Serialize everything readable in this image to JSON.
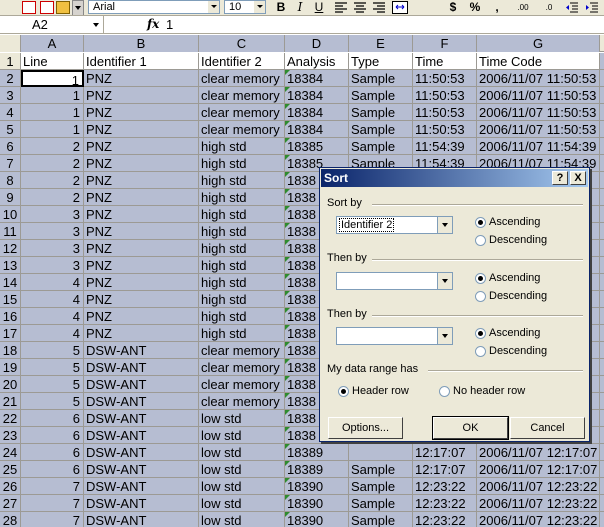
{
  "toolbar": {
    "font_name": "Arial",
    "font_size": "10",
    "bold": "B",
    "italic": "I",
    "underline": "U",
    "currency": "$",
    "percent": "%",
    "comma": ",",
    "increase_decimal": ".00",
    "decrease_decimal": ".0"
  },
  "formula_bar": {
    "cell_ref": "A2",
    "fx": "fx",
    "value": "1"
  },
  "sheet": {
    "columns": [
      "A",
      "B",
      "C",
      "D",
      "E",
      "F",
      "G"
    ],
    "header": [
      "Line",
      "Identifier 1",
      "Identifier 2",
      "Analysis",
      "Type",
      "Time",
      "Time Code"
    ],
    "rows": [
      {
        "n": "2",
        "cells": [
          "1",
          "PNZ",
          "clear memory",
          "18384",
          "Sample",
          "11:50:53",
          "2006/11/07 11:50:53"
        ]
      },
      {
        "n": "3",
        "cells": [
          "1",
          "PNZ",
          "clear memory",
          "18384",
          "Sample",
          "11:50:53",
          "2006/11/07 11:50:53"
        ]
      },
      {
        "n": "4",
        "cells": [
          "1",
          "PNZ",
          "clear memory",
          "18384",
          "Sample",
          "11:50:53",
          "2006/11/07 11:50:53"
        ]
      },
      {
        "n": "5",
        "cells": [
          "1",
          "PNZ",
          "clear memory",
          "18384",
          "Sample",
          "11:50:53",
          "2006/11/07 11:50:53"
        ]
      },
      {
        "n": "6",
        "cells": [
          "2",
          "PNZ",
          "high std",
          "18385",
          "Sample",
          "11:54:39",
          "2006/11/07 11:54:39"
        ]
      },
      {
        "n": "7",
        "cells": [
          "2",
          "PNZ",
          "high std",
          "18385",
          "Sample",
          "11:54:39",
          "2006/11/07 11:54:39"
        ]
      },
      {
        "n": "8",
        "cells": [
          "2",
          "PNZ",
          "high std",
          "1838",
          "",
          "",
          ""
        ]
      },
      {
        "n": "9",
        "cells": [
          "2",
          "PNZ",
          "high std",
          "1838",
          "",
          "",
          ""
        ]
      },
      {
        "n": "10",
        "cells": [
          "3",
          "PNZ",
          "high std",
          "1838",
          "",
          "",
          ""
        ]
      },
      {
        "n": "11",
        "cells": [
          "3",
          "PNZ",
          "high std",
          "1838",
          "",
          "",
          ""
        ]
      },
      {
        "n": "12",
        "cells": [
          "3",
          "PNZ",
          "high std",
          "1838",
          "",
          "",
          ""
        ]
      },
      {
        "n": "13",
        "cells": [
          "3",
          "PNZ",
          "high std",
          "1838",
          "",
          "",
          ""
        ]
      },
      {
        "n": "14",
        "cells": [
          "4",
          "PNZ",
          "high std",
          "1838",
          "",
          "",
          ""
        ]
      },
      {
        "n": "15",
        "cells": [
          "4",
          "PNZ",
          "high std",
          "1838",
          "",
          "",
          ""
        ]
      },
      {
        "n": "16",
        "cells": [
          "4",
          "PNZ",
          "high std",
          "1838",
          "",
          "",
          ""
        ]
      },
      {
        "n": "17",
        "cells": [
          "4",
          "PNZ",
          "high std",
          "1838",
          "",
          "",
          ""
        ]
      },
      {
        "n": "18",
        "cells": [
          "5",
          "DSW-ANT",
          "clear memory",
          "1838",
          "",
          "",
          ""
        ]
      },
      {
        "n": "19",
        "cells": [
          "5",
          "DSW-ANT",
          "clear memory",
          "1838",
          "",
          "",
          ""
        ]
      },
      {
        "n": "20",
        "cells": [
          "5",
          "DSW-ANT",
          "clear memory",
          "1838",
          "",
          "",
          ""
        ]
      },
      {
        "n": "21",
        "cells": [
          "5",
          "DSW-ANT",
          "clear memory",
          "1838",
          "",
          "",
          ""
        ]
      },
      {
        "n": "22",
        "cells": [
          "6",
          "DSW-ANT",
          "low std",
          "1838",
          "",
          "",
          ""
        ]
      },
      {
        "n": "23",
        "cells": [
          "6",
          "DSW-ANT",
          "low std",
          "1838",
          "",
          "",
          ""
        ]
      },
      {
        "n": "24",
        "cells": [
          "6",
          "DSW-ANT",
          "low std",
          "18389",
          "",
          "12:17:07",
          "2006/11/07 12:17:07"
        ]
      },
      {
        "n": "25",
        "cells": [
          "6",
          "DSW-ANT",
          "low std",
          "18389",
          "Sample",
          "12:17:07",
          "2006/11/07 12:17:07"
        ]
      },
      {
        "n": "26",
        "cells": [
          "7",
          "DSW-ANT",
          "low std",
          "18390",
          "Sample",
          "12:23:22",
          "2006/11/07 12:23:22"
        ]
      },
      {
        "n": "27",
        "cells": [
          "7",
          "DSW-ANT",
          "low std",
          "18390",
          "Sample",
          "12:23:22",
          "2006/11/07 12:23:22"
        ]
      },
      {
        "n": "28",
        "cells": [
          "7",
          "DSW-ANT",
          "low std",
          "18390",
          "Sample",
          "12:23:22",
          "2006/11/07 12:23:22"
        ]
      }
    ]
  },
  "dialog": {
    "title": "Sort",
    "help": "?",
    "close": "X",
    "sort_by_label": "Sort by",
    "sort_by_value": "Identifier 2",
    "then_by_1_label": "Then by",
    "then_by_1_value": "",
    "then_by_2_label": "Then by",
    "then_by_2_value": "",
    "ascending": "Ascending",
    "descending": "Descending",
    "range_label": "My data range has",
    "header_row": "Header row",
    "no_header_row": "No header row",
    "options_button": "Options...",
    "ok_button": "OK",
    "cancel_button": "Cancel"
  }
}
